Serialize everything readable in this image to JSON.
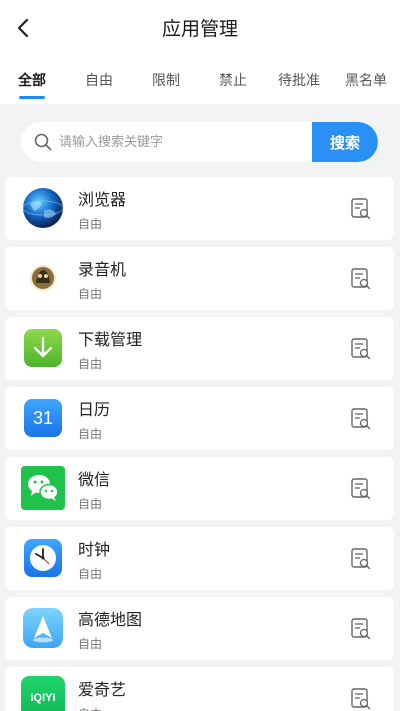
{
  "header": {
    "title": "应用管理",
    "back_icon": "chevron-left-icon"
  },
  "tabs": [
    {
      "label": "全部",
      "active": true
    },
    {
      "label": "自由",
      "active": false
    },
    {
      "label": "限制",
      "active": false
    },
    {
      "label": "禁止",
      "active": false
    },
    {
      "label": "待批准",
      "active": false
    },
    {
      "label": "黑名单",
      "active": false
    }
  ],
  "search": {
    "placeholder": "请输入搜索关键字",
    "button_label": "搜索"
  },
  "colors": {
    "accent": "#2a8ff7",
    "background": "#f2f3f5"
  },
  "apps": [
    {
      "name": "浏览器",
      "status": "自由",
      "icon": "browser-globe-icon"
    },
    {
      "name": "录音机",
      "status": "自由",
      "icon": "recorder-icon"
    },
    {
      "name": "下载管理",
      "status": "自由",
      "icon": "download-arrow-icon"
    },
    {
      "name": "日历",
      "status": "自由",
      "icon": "calendar-icon",
      "icon_text": "31"
    },
    {
      "name": "微信",
      "status": "自由",
      "icon": "wechat-icon"
    },
    {
      "name": "时钟",
      "status": "自由",
      "icon": "clock-icon"
    },
    {
      "name": "高德地图",
      "status": "自由",
      "icon": "amap-icon"
    },
    {
      "name": "爱奇艺",
      "status": "自由",
      "icon": "iqiyi-icon",
      "icon_text": "iQIYI"
    }
  ]
}
